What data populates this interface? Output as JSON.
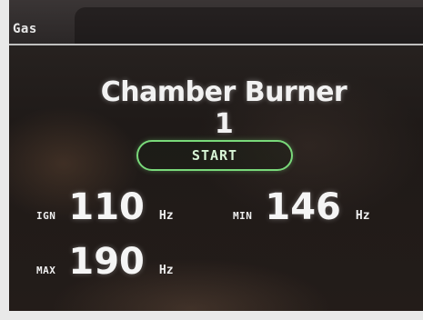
{
  "header": {
    "title": "Gas"
  },
  "main": {
    "title": "Chamber Burner 1",
    "start_label": "START",
    "readouts": {
      "ign": {
        "label": "IGN",
        "value": "110",
        "unit": "Hz"
      },
      "min": {
        "label": "MIN",
        "value": "146",
        "unit": "Hz"
      },
      "max": {
        "label": "MAX",
        "value": "190",
        "unit": "Hz"
      }
    }
  },
  "colors": {
    "accent": "#79d97a",
    "text": "#f5f5f5",
    "background": "#231c19"
  }
}
